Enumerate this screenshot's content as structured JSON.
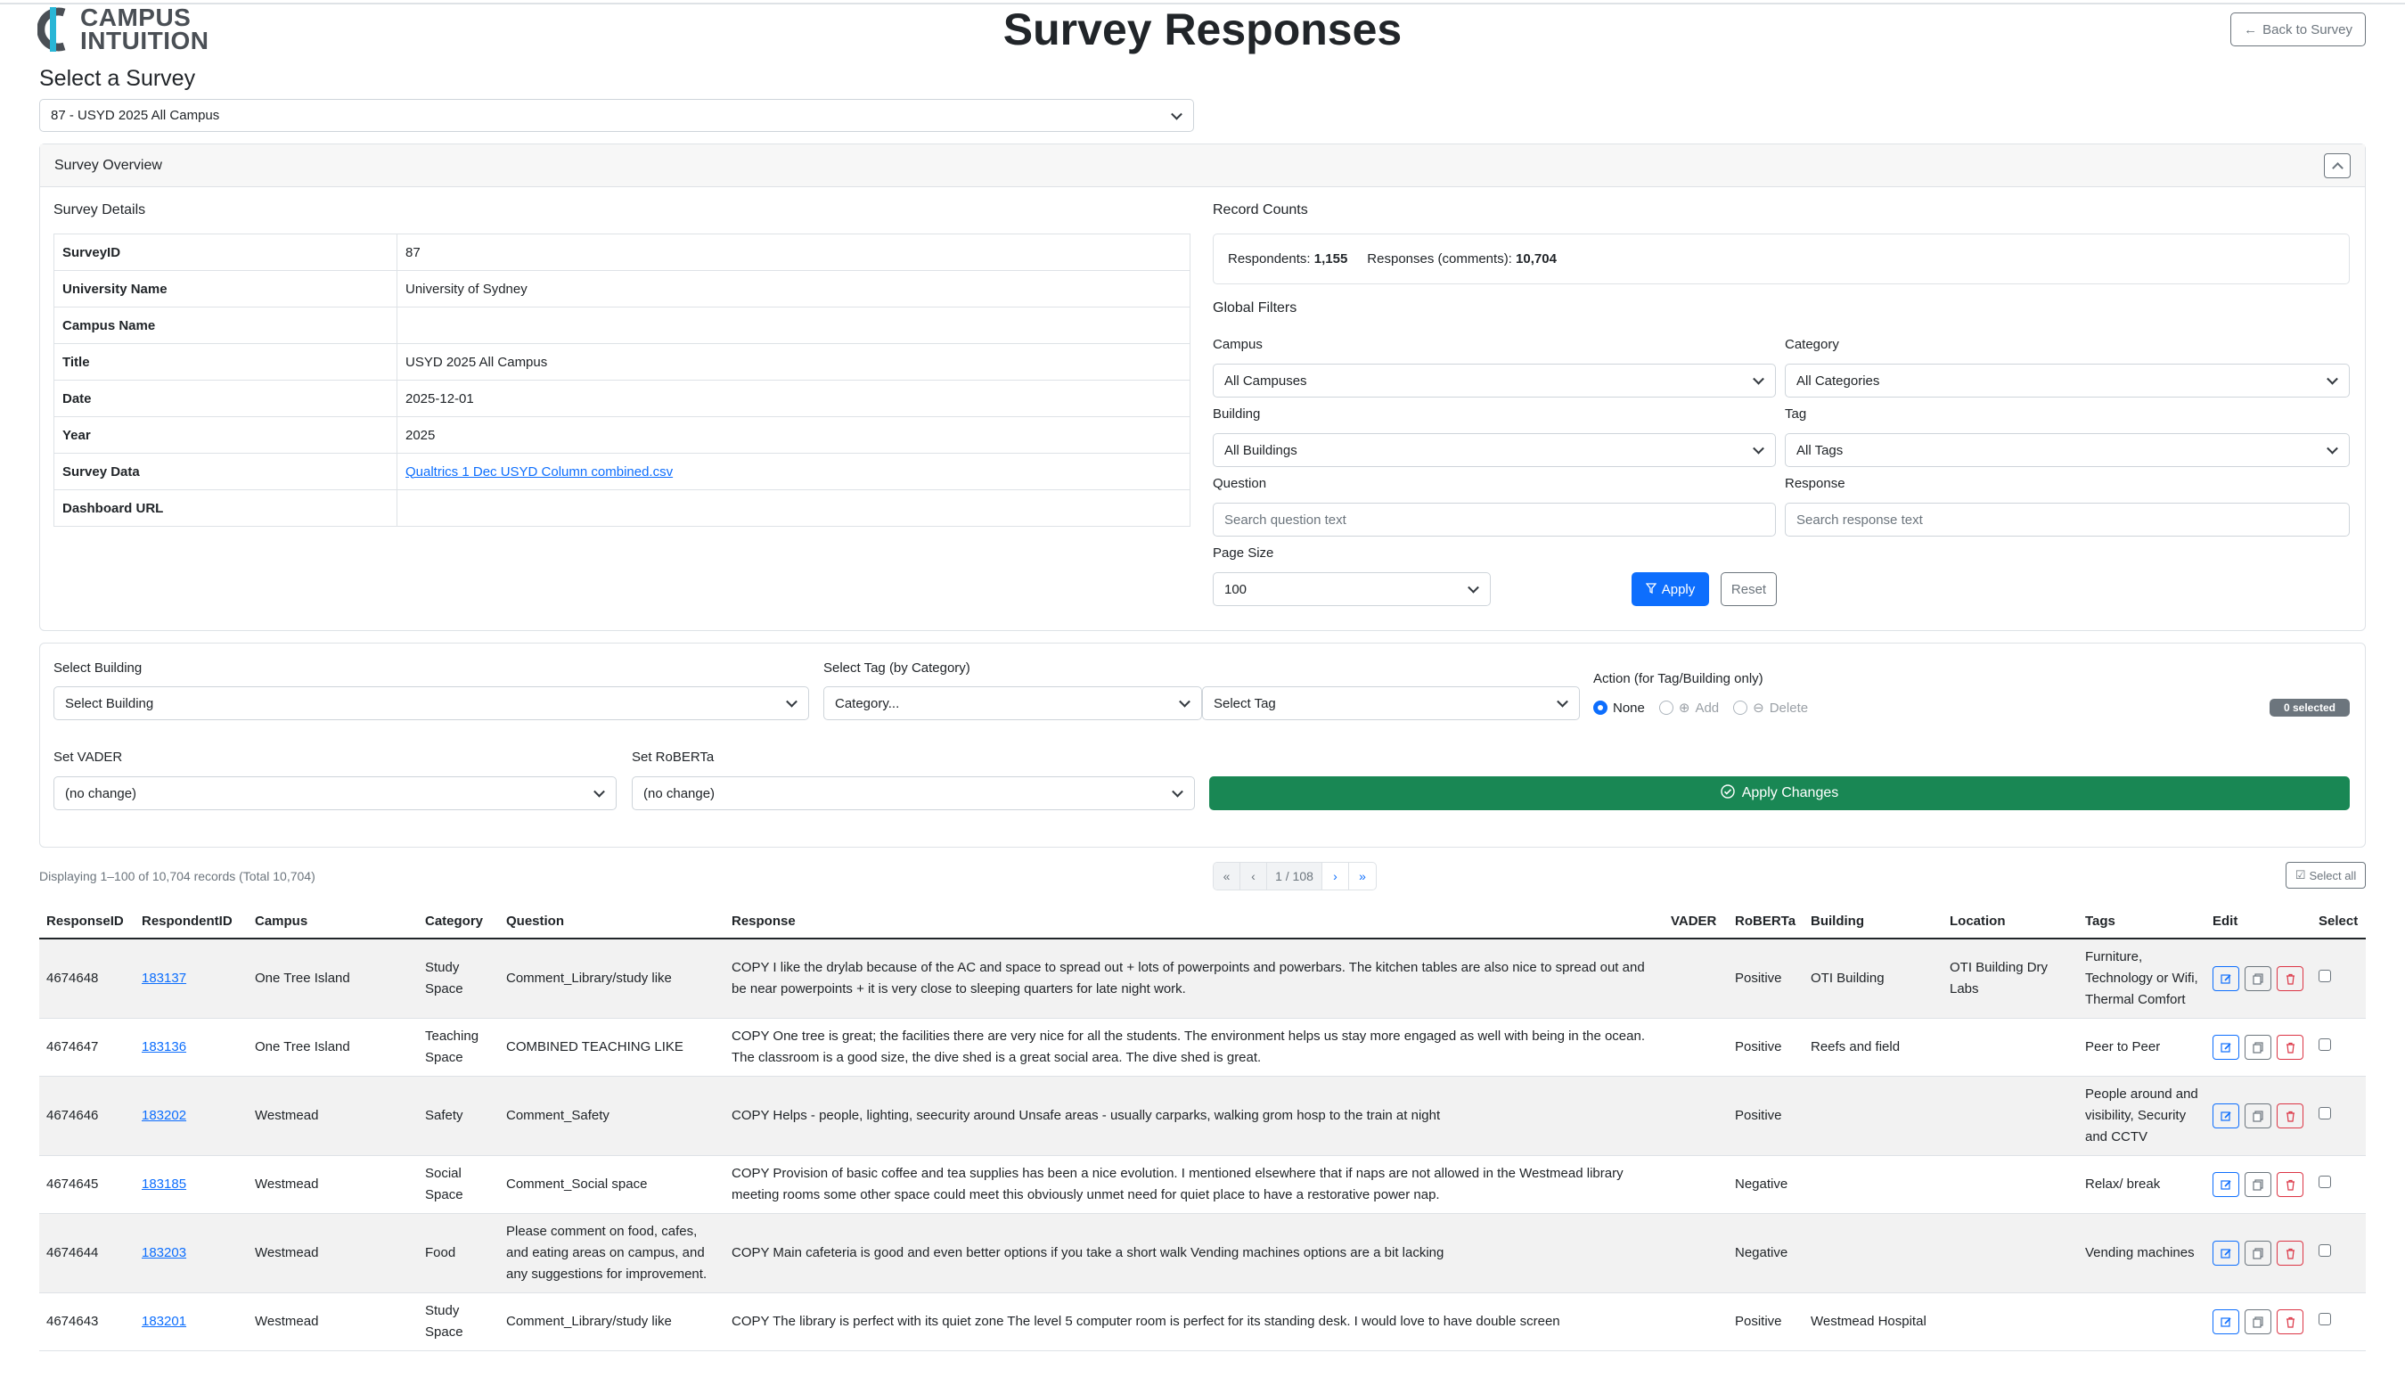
{
  "brand": {
    "line1": "CAMPUS",
    "line2": "INTUITION"
  },
  "header": {
    "title": "Survey Responses",
    "back_label": "Back to Survey"
  },
  "survey_select": {
    "label": "Select a Survey",
    "value": "87 - USYD 2025 All Campus"
  },
  "overview": {
    "title": "Survey Overview",
    "details_title": "Survey Details",
    "details": [
      {
        "key": "SurveyID",
        "value": "87"
      },
      {
        "key": "University Name",
        "value": "University of Sydney"
      },
      {
        "key": "Campus Name",
        "value": ""
      },
      {
        "key": "Title",
        "value": "USYD 2025 All Campus"
      },
      {
        "key": "Date",
        "value": "2025-12-01"
      },
      {
        "key": "Year",
        "value": "2025"
      },
      {
        "key": "Survey Data",
        "value": "Qualtrics 1 Dec USYD Column combined.csv"
      },
      {
        "key": "Dashboard URL",
        "value": ""
      }
    ],
    "counts_title": "Record Counts",
    "respondents_label": "Respondents:",
    "respondents_value": "1,155",
    "responses_label": "Responses (comments):",
    "responses_value": "10,704"
  },
  "filters": {
    "title": "Global Filters",
    "campus_label": "Campus",
    "campus_value": "All Campuses",
    "category_label": "Category",
    "category_value": "All Categories",
    "building_label": "Building",
    "building_value": "All Buildings",
    "tag_label": "Tag",
    "tag_value": "All Tags",
    "question_label": "Question",
    "question_placeholder": "Search question text",
    "response_label": "Response",
    "response_placeholder": "Search response text",
    "page_size_label": "Page Size",
    "page_size_value": "100",
    "apply_label": "Apply",
    "reset_label": "Reset"
  },
  "bulk": {
    "building_label": "Select Building",
    "building_value": "Select Building",
    "tag_label": "Select Tag (by Category)",
    "category_value": "Category...",
    "tag_value": "Select Tag",
    "action_label": "Action (for Tag/Building only)",
    "actions": [
      "None",
      "Add",
      "Delete"
    ],
    "selected_badge": "0 selected",
    "vader_label": "Set VADER",
    "vader_value": "(no change)",
    "roberta_label": "Set RoBERTa",
    "roberta_value": "(no change)",
    "apply_changes_label": "Apply Changes"
  },
  "listing": {
    "display_info": "Displaying 1–100 of 10,704 records (Total 10,704)",
    "page_indicator": "1 / 108",
    "select_all_label": "Select all"
  },
  "table": {
    "columns": [
      "ResponseID",
      "RespondentID",
      "Campus",
      "Category",
      "Question",
      "Response",
      "VADER",
      "RoBERTa",
      "Building",
      "Location",
      "Tags",
      "Edit",
      "Select"
    ],
    "rows": [
      {
        "id": "4674648",
        "respondent": "183137",
        "campus": "One Tree Island",
        "category": "Study Space",
        "question": "Comment_Library/study like",
        "response": "COPY I like the drylab because of the AC and space to spread out + lots of powerpoints and powerbars. The kitchen tables are also nice to spread out and be near powerpoints + it is very close to sleeping quarters for late night work.",
        "vader": "",
        "roberta": "Positive",
        "building": "OTI Building",
        "location": "OTI Building Dry Labs",
        "tags": "Furniture, Technology or Wifi, Thermal Comfort"
      },
      {
        "id": "4674647",
        "respondent": "183136",
        "campus": "One Tree Island",
        "category": "Teaching Space",
        "question": "COMBINED TEACHING LIKE",
        "response": "COPY One tree is great; the facilities there are very nice for all the students. The environment helps us stay more engaged as well with being in the ocean. The classroom is a good size, the dive shed is a great social area. The dive shed is great.",
        "vader": "",
        "roberta": "Positive",
        "building": "Reefs and field",
        "location": "",
        "tags": "Peer to Peer"
      },
      {
        "id": "4674646",
        "respondent": "183202",
        "campus": "Westmead",
        "category": "Safety",
        "question": "Comment_Safety",
        "response": "COPY Helps - people, lighting, seecurity around Unsafe areas - usually carparks, walking grom hosp to the train at night",
        "vader": "",
        "roberta": "Positive",
        "building": "",
        "location": "",
        "tags": "People around and visibility, Security and CCTV"
      },
      {
        "id": "4674645",
        "respondent": "183185",
        "campus": "Westmead",
        "category": "Social Space",
        "question": "Comment_Social space",
        "response": "COPY Provision of basic coffee and tea supplies has been a nice evolution. I mentioned elsewhere that if naps are not allowed in the Westmead library meeting rooms some other space could meet this obviously unmet need for quiet place to have a restorative power nap.",
        "vader": "",
        "roberta": "Negative",
        "building": "",
        "location": "",
        "tags": "Relax/ break"
      },
      {
        "id": "4674644",
        "respondent": "183203",
        "campus": "Westmead",
        "category": "Food",
        "question": "Please comment on food, cafes, and eating areas on campus, and any suggestions for improvement.",
        "response": "COPY Main cafeteria is good and even better options if you take a short walk Vending machines options are a bit lacking",
        "vader": "",
        "roberta": "Negative",
        "building": "",
        "location": "",
        "tags": "Vending machines"
      },
      {
        "id": "4674643",
        "respondent": "183201",
        "campus": "Westmead",
        "category": "Study Space",
        "question": "Comment_Library/study like",
        "response": "COPY The library is perfect with its quiet zone The level 5 computer room is perfect for its standing desk. I would love to have double screen",
        "vader": "",
        "roberta": "Positive",
        "building": "Westmead Hospital",
        "location": "",
        "tags": ""
      }
    ]
  },
  "colors": {
    "primary": "#0d6efd",
    "success": "#198754",
    "danger": "#dc3545",
    "secondary": "#6c757d"
  }
}
